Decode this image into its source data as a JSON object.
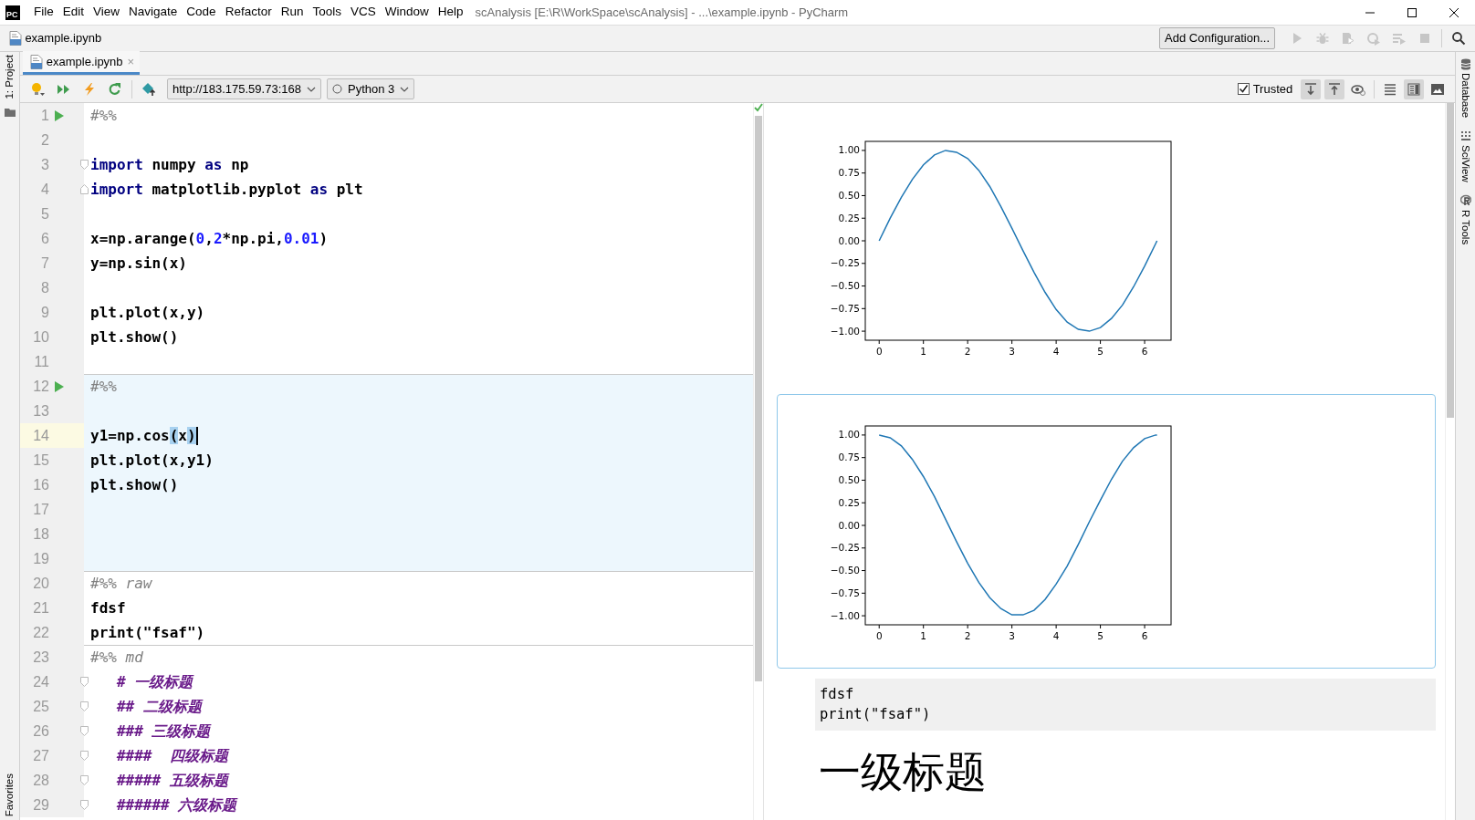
{
  "window": {
    "logo": "PC",
    "menu": [
      "File",
      "Edit",
      "View",
      "Navigate",
      "Code",
      "Refactor",
      "Run",
      "Tools",
      "VCS",
      "Window",
      "Help"
    ],
    "title": "scAnalysis [E:\\R\\WorkSpace\\scAnalysis] - ...\\example.ipynb - PyCharm"
  },
  "navbar": {
    "file": {
      "name": "example.ipynb"
    },
    "add_configuration": "Add Configuration...",
    "run_buttons": [
      {
        "disabled": true
      },
      {
        "disabled": true
      },
      {
        "disabled": true
      },
      {
        "disabled": true
      },
      {
        "disabled": true
      },
      {
        "disabled": true
      }
    ]
  },
  "left_strip": {
    "top": "1: Project",
    "bottom": "Favorites"
  },
  "right_strip": [
    "Database",
    "SciView",
    "R Tools"
  ],
  "tabs": [
    {
      "label": "example.ipynb",
      "close": "×",
      "selected": true
    }
  ],
  "notebook_toolbar": {
    "server": "http://183.175.59.73:168",
    "kernel": "Python 3",
    "trusted": {
      "label": "Trusted",
      "checked": true
    },
    "view_buttons": [
      {
        "selected": true
      },
      {
        "selected": true
      },
      {
        "selected": false
      }
    ],
    "layout_buttons": [
      {
        "selected": false
      },
      {
        "selected": true
      },
      {
        "selected": false
      }
    ]
  },
  "editor": {
    "cells": [
      {
        "selected": false,
        "lines": [
          {
            "number": "1",
            "kind": "run",
            "current": false,
            "tokens": [
              {
                "kind": "comment",
                "text": "#%%"
              }
            ]
          },
          {
            "number": "2",
            "kind": "plain",
            "current": false
          },
          {
            "number": "3",
            "kind": "fold-start",
            "current": false,
            "tokens": [
              {
                "kind": "keyword",
                "text": "import"
              },
              {
                "kind": "plain",
                "text": " numpy "
              },
              {
                "kind": "keyword",
                "text": "as"
              },
              {
                "kind": "plain",
                "text": " np"
              }
            ]
          },
          {
            "number": "4",
            "kind": "fold-end",
            "current": false,
            "tokens": [
              {
                "kind": "keyword",
                "text": "import"
              },
              {
                "kind": "plain",
                "text": " matplotlib.pyplot "
              },
              {
                "kind": "keyword",
                "text": "as"
              },
              {
                "kind": "plain",
                "text": " plt"
              }
            ]
          },
          {
            "number": "5",
            "kind": "plain",
            "current": false
          },
          {
            "number": "6",
            "kind": "plain",
            "current": false,
            "tokens": [
              {
                "kind": "plain",
                "text": "x=np.arange("
              },
              {
                "kind": "number",
                "text": "0"
              },
              {
                "kind": "plain",
                "text": ","
              },
              {
                "kind": "number",
                "text": "2"
              },
              {
                "kind": "plain",
                "text": "*np.pi,"
              },
              {
                "kind": "number",
                "text": "0.01"
              },
              {
                "kind": "plain",
                "text": ")"
              }
            ]
          },
          {
            "number": "7",
            "kind": "plain",
            "current": false,
            "tokens": [
              {
                "kind": "plain",
                "text": "y=np.sin(x)"
              }
            ]
          },
          {
            "number": "8",
            "kind": "plain",
            "current": false
          },
          {
            "number": "9",
            "kind": "plain",
            "current": false,
            "tokens": [
              {
                "kind": "plain",
                "text": "plt.plot(x,y)"
              }
            ]
          },
          {
            "number": "10",
            "kind": "plain",
            "current": false,
            "tokens": [
              {
                "kind": "plain",
                "text": "plt.show()"
              }
            ]
          },
          {
            "number": "11",
            "kind": "plain",
            "current": false
          }
        ]
      },
      {
        "selected": true,
        "lines": [
          {
            "number": "12",
            "kind": "run",
            "current": false,
            "tokens": [
              {
                "kind": "comment",
                "text": "#%%"
              }
            ]
          },
          {
            "number": "13",
            "kind": "plain",
            "current": false
          },
          {
            "number": "14",
            "kind": "plain",
            "current": true,
            "caret": true,
            "tokens": [
              {
                "kind": "plain",
                "text": "y1=np.cos"
              },
              {
                "kind": "match",
                "text": "("
              },
              {
                "kind": "plain",
                "text": "x"
              },
              {
                "kind": "match",
                "text": ")"
              }
            ]
          },
          {
            "number": "15",
            "kind": "plain",
            "current": false,
            "tokens": [
              {
                "kind": "plain",
                "text": "plt.plot(x,y1)"
              }
            ]
          },
          {
            "number": "16",
            "kind": "plain",
            "current": false,
            "tokens": [
              {
                "kind": "plain",
                "text": "plt.show()"
              }
            ]
          },
          {
            "number": "17",
            "kind": "plain",
            "current": false
          },
          {
            "number": "18",
            "kind": "plain",
            "current": false
          },
          {
            "number": "19",
            "kind": "plain",
            "current": false
          }
        ]
      },
      {
        "selected": false,
        "lines": [
          {
            "number": "20",
            "kind": "plain",
            "current": false,
            "tokens": [
              {
                "kind": "comment",
                "text": "#%% raw"
              }
            ]
          },
          {
            "number": "21",
            "kind": "plain",
            "current": false,
            "tokens": [
              {
                "kind": "plain",
                "text": "fdsf"
              }
            ]
          },
          {
            "number": "22",
            "kind": "plain",
            "current": false,
            "tokens": [
              {
                "kind": "plain",
                "text": "print(\"fsaf\")"
              }
            ]
          }
        ]
      },
      {
        "selected": false,
        "lines": [
          {
            "number": "23",
            "kind": "plain",
            "current": false,
            "tokens": [
              {
                "kind": "comment",
                "text": "#%% md"
              }
            ]
          },
          {
            "number": "24",
            "kind": "fold",
            "current": false,
            "tokens": [
              {
                "kind": "markdown",
                "text": "   # 一级标题"
              }
            ]
          },
          {
            "number": "25",
            "kind": "fold",
            "current": false,
            "tokens": [
              {
                "kind": "markdown",
                "text": "   ## 二级标题"
              }
            ]
          },
          {
            "number": "26",
            "kind": "fold",
            "current": false,
            "tokens": [
              {
                "kind": "markdown",
                "text": "   ### 三级标题"
              }
            ]
          },
          {
            "number": "27",
            "kind": "fold",
            "current": false,
            "tokens": [
              {
                "kind": "markdown",
                "text": "   ####  四级标题"
              }
            ]
          },
          {
            "number": "28",
            "kind": "fold",
            "current": false,
            "tokens": [
              {
                "kind": "markdown",
                "text": "   ##### 五级标题"
              }
            ]
          },
          {
            "number": "29",
            "kind": "fold",
            "current": false,
            "tokens": [
              {
                "kind": "markdown",
                "text": "   ###### 六级标题"
              }
            ]
          }
        ]
      }
    ]
  },
  "preview": {
    "outputs": [
      {
        "kind": "chart",
        "selected": false,
        "chart_data": {
          "type": "line",
          "x": [
            0,
            0.25,
            0.5,
            0.75,
            1,
            1.25,
            1.5,
            1.75,
            2,
            2.25,
            2.5,
            2.75,
            3,
            3.25,
            3.5,
            3.75,
            4,
            4.25,
            4.5,
            4.75,
            5,
            5.25,
            5.5,
            5.75,
            6,
            6.25,
            6.28
          ],
          "xlim": [
            -0.314,
            6.597
          ],
          "ylim": [
            -1.1,
            1.1
          ],
          "xticks": [
            0,
            1,
            2,
            3,
            4,
            5,
            6
          ],
          "yticks": [
            {
              "value": 1,
              "label": "1.00"
            },
            {
              "value": 0.75,
              "label": "0.75"
            },
            {
              "value": 0.5,
              "label": "0.50"
            },
            {
              "value": 0.25,
              "label": "0.25"
            },
            {
              "value": 0,
              "label": "0.00"
            },
            {
              "value": -0.25,
              "label": "−0.25"
            },
            {
              "value": -0.5,
              "label": "−0.50"
            },
            {
              "value": -0.75,
              "label": "−0.75"
            },
            {
              "value": -1,
              "label": "−1.00"
            }
          ],
          "series": [
            {
              "color": "#1f77b4",
              "values": [
                0,
                0.25,
                0.48,
                0.68,
                0.84,
                0.95,
                1,
                0.98,
                0.91,
                0.78,
                0.6,
                0.38,
                0.14,
                -0.11,
                -0.35,
                -0.57,
                -0.76,
                -0.9,
                -0.98,
                -1,
                -0.96,
                -0.86,
                -0.71,
                -0.51,
                -0.28,
                -0.03,
                0
              ]
            }
          ]
        }
      },
      {
        "kind": "chart",
        "selected": true,
        "chart_data": {
          "type": "line",
          "x": [
            0,
            0.25,
            0.5,
            0.75,
            1,
            1.25,
            1.5,
            1.75,
            2,
            2.25,
            2.5,
            2.75,
            3,
            3.25,
            3.5,
            3.75,
            4,
            4.25,
            4.5,
            4.75,
            5,
            5.25,
            5.5,
            5.75,
            6,
            6.25,
            6.28
          ],
          "xlim": [
            -0.314,
            6.597
          ],
          "ylim": [
            -1.1,
            1.1
          ],
          "xticks": [
            0,
            1,
            2,
            3,
            4,
            5,
            6
          ],
          "yticks": [
            {
              "value": 1,
              "label": "1.00"
            },
            {
              "value": 0.75,
              "label": "0.75"
            },
            {
              "value": 0.5,
              "label": "0.50"
            },
            {
              "value": 0.25,
              "label": "0.25"
            },
            {
              "value": 0,
              "label": "0.00"
            },
            {
              "value": -0.25,
              "label": "−0.25"
            },
            {
              "value": -0.5,
              "label": "−0.50"
            },
            {
              "value": -0.75,
              "label": "−0.75"
            },
            {
              "value": -1,
              "label": "−1.00"
            }
          ],
          "series": [
            {
              "color": "#1f77b4",
              "values": [
                1,
                0.97,
                0.88,
                0.73,
                0.54,
                0.32,
                0.07,
                -0.18,
                -0.42,
                -0.63,
                -0.8,
                -0.92,
                -0.99,
                -0.99,
                -0.94,
                -0.82,
                -0.65,
                -0.45,
                -0.21,
                0.04,
                0.28,
                0.51,
                0.71,
                0.86,
                0.96,
                1,
                1
              ]
            }
          ]
        }
      },
      {
        "kind": "raw",
        "lines": [
          "fdsf",
          "print(\"fsaf\")"
        ]
      },
      {
        "kind": "heading",
        "text": "一级标题"
      }
    ]
  }
}
